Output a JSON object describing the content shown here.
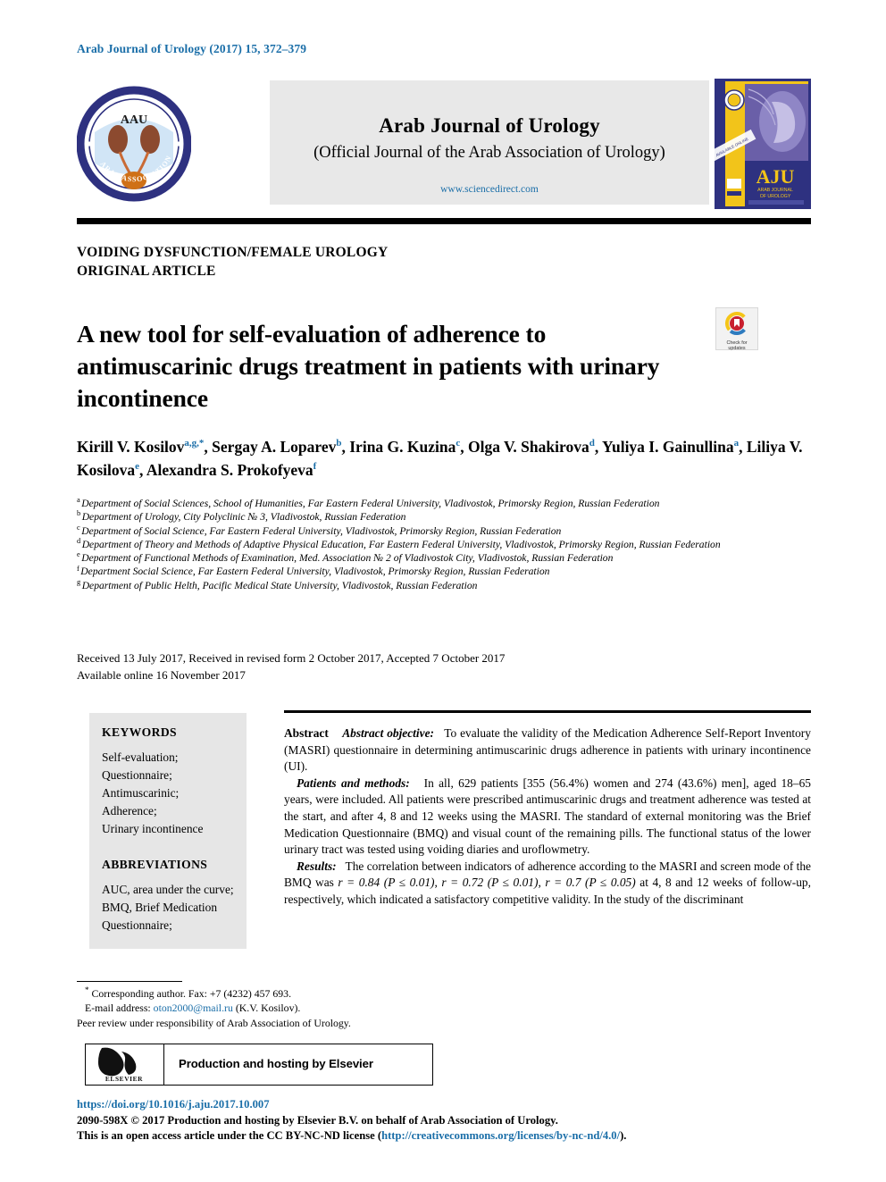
{
  "running_head": "Arab Journal of Urology (2017) 15, 372–379",
  "masthead": {
    "logo_alt": "Arab Association of Urology logo",
    "logo_initials": "AAU",
    "logo_ring_text": "ARAB ASSOCIATION OF UROLOGY",
    "journal_title": "Arab Journal of Urology",
    "journal_subtitle": "(Official Journal of the Arab Association of Urology)",
    "url": "www.sciencedirect.com",
    "cover_title": "AJU",
    "cover_sub": "ARAB JOURNAL OF UROLOGY"
  },
  "section": {
    "line1": "VOIDING DYSFUNCTION/FEMALE UROLOGY",
    "line2": "ORIGINAL ARTICLE"
  },
  "title": "A new tool for self-evaluation of adherence to antimuscarinic drugs treatment in patients with urinary incontinence",
  "crossmark": {
    "line1": "Check for",
    "line2": "updates"
  },
  "authors": [
    {
      "name": "Kirill V. Kosilov",
      "marks": "a,g,*",
      "sep": ", "
    },
    {
      "name": "Sergay A. Loparev",
      "marks": "b",
      "sep": ", "
    },
    {
      "name": "Irina G. Kuzina",
      "marks": "c",
      "sep": ", "
    },
    {
      "name": "Olga V. Shakirova",
      "marks": "d",
      "sep": ", "
    },
    {
      "name": "Yuliya I. Gainullina",
      "marks": "a",
      "sep": ", "
    },
    {
      "name": "Liliya V. Kosilova",
      "marks": "e",
      "sep": ", "
    },
    {
      "name": "Alexandra S. Prokofyeva",
      "marks": "f",
      "sep": ""
    }
  ],
  "affiliations": [
    {
      "mark": "a",
      "text": "Department of Social Sciences, School of Humanities, Far Eastern Federal University, Vladivostok, Primorsky Region, Russian Federation"
    },
    {
      "mark": "b",
      "text": "Department of Urology, City Polyclinic № 3, Vladivostok, Russian Federation"
    },
    {
      "mark": "c",
      "text": "Department of Social Science, Far Eastern Federal University, Vladivostok, Primorsky Region, Russian Federation"
    },
    {
      "mark": "d",
      "text": "Department of Theory and Methods of Adaptive Physical Education, Far Eastern Federal University, Vladivostok, Primorsky Region, Russian Federation"
    },
    {
      "mark": "e",
      "text": "Department of Functional Methods of Examination, Med. Association № 2 of Vladivostok City, Vladivostok, Russian Federation"
    },
    {
      "mark": "f",
      "text": "Department Social Science, Far Eastern Federal University, Vladivostok, Primorsky Region, Russian Federation"
    },
    {
      "mark": "g",
      "text": "Department of Public Helth, Pacific Medical State University, Vladivostok, Russian Federation"
    }
  ],
  "history": {
    "line1": "Received 13 July 2017, Received in revised form 2 October 2017, Accepted 7 October 2017",
    "line2": "Available online 16 November 2017"
  },
  "keywords": {
    "heading": "KEYWORDS",
    "items": "Self-evaluation; Questionnaire; Antimuscarinic; Adherence; Urinary incontinence",
    "abbrev_heading": "ABBREVIATIONS",
    "abbrev_items": "AUC, area under the curve; BMQ, Brief Medication Questionnaire;"
  },
  "abstract": {
    "label": "Abstract",
    "objective_label": "Abstract objective:",
    "objective_text": "To evaluate the validity of the Medication Adherence Self-Report Inventory (MASRI) questionnaire in determining antimuscarinic drugs adherence in patients with urinary incontinence (UI).",
    "methods_label": "Patients and methods:",
    "methods_text": "In all, 629 patients [355 (56.4%) women and 274 (43.6%) men], aged 18–65 years, were included. All patients were prescribed antimuscarinic drugs and treatment adherence was tested at the start, and after 4, 8 and 12 weeks using the MASRI. The standard of external monitoring was the Brief Medication Questionnaire (BMQ) and visual count of the remaining pills. The functional status of the lower urinary tract was tested using voiding diaries and uroflowmetry.",
    "results_label": "Results:",
    "results_text_a": "The correlation between indicators of adherence according to the MASRI and screen mode of the BMQ was ",
    "results_stat1": "r = 0.84",
    "results_p1": "(P ≤ 0.01)",
    "results_stat2": "r = 0.72",
    "results_p2": "(P ≤ 0.01)",
    "results_stat3": "r = 0.7",
    "results_p3": "(P ≤ 0.05)",
    "results_text_b": " at 4, 8 and 12 weeks of follow-up, respectively, which indicated a satisfactory competitive validity. In the study of the discriminant"
  },
  "footnotes": {
    "corresponding": "Corresponding author. Fax: +7 (4232) 457 693.",
    "email_label": "E-mail address:",
    "email": "oton2000@mail.ru",
    "email_owner": "(K.V. Kosilov).",
    "peer_review": "Peer review under responsibility of Arab Association of Urology."
  },
  "elsevier": {
    "wordmark": "ELSEVIER",
    "label": "Production and hosting by Elsevier"
  },
  "bottom": {
    "doi": "https://doi.org/10.1016/j.aju.2017.10.007",
    "copyright": "2090-598X © 2017 Production and hosting by Elsevier B.V. on behalf of Arab Association of Urology.",
    "license_pre": "This is an open access article under the CC BY-NC-ND license (",
    "license_url": "http://creativecommons.org/licenses/by-nc-nd/4.0/",
    "license_post": ")."
  },
  "colors": {
    "accent_blue": "#1a6ea8",
    "panel_gray": "#e6e6e6",
    "banner_gray": "#e8e8e8",
    "logo_navy": "#2e3180",
    "cover_yellow": "#f2c41a",
    "crossmark_red": "#c8202f"
  }
}
